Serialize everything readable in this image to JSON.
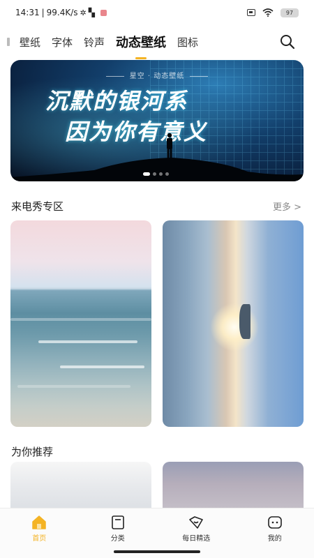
{
  "status_bar": {
    "time": "14:31",
    "net_speed": "99.4K/s",
    "battery": "97"
  },
  "top_tabs": [
    {
      "label": "壁纸"
    },
    {
      "label": "字体"
    },
    {
      "label": "铃声"
    },
    {
      "label": "动态壁纸",
      "active": true
    },
    {
      "label": "图标"
    }
  ],
  "search": {
    "icon": "search-icon"
  },
  "banner": {
    "caption": "星空 · 动态壁纸",
    "line1": "沉默的银河系",
    "line2": "因为你有意义",
    "page_count": 4,
    "active_index": 0
  },
  "section_caller": {
    "title": "来电秀专区",
    "more": "更多 >"
  },
  "section_recommend": {
    "title": "为你推荐"
  },
  "bottom_nav": [
    {
      "label": "首页",
      "icon": "home-icon",
      "active": true
    },
    {
      "label": "分类",
      "icon": "category-icon"
    },
    {
      "label": "每日精选",
      "icon": "daily-picks-icon"
    },
    {
      "label": "我的",
      "icon": "profile-icon"
    }
  ],
  "colors": {
    "accent": "#f4b324"
  }
}
